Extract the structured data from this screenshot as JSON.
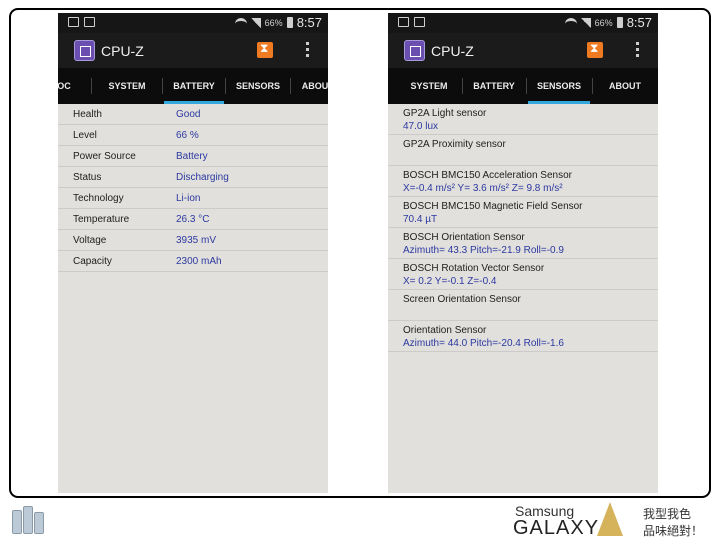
{
  "status_bar": {
    "battery_pct": "66%",
    "time": "8:57"
  },
  "app": {
    "title": "CPU-Z"
  },
  "left_tabs": [
    "OC",
    "SYSTEM",
    "BATTERY",
    "SENSORS",
    "ABOU"
  ],
  "right_tabs": [
    "SYSTEM",
    "BATTERY",
    "SENSORS",
    "ABOUT"
  ],
  "battery": [
    {
      "label": "Health",
      "value": "Good"
    },
    {
      "label": "Level",
      "value": "66 %"
    },
    {
      "label": "Power Source",
      "value": "Battery"
    },
    {
      "label": "Status",
      "value": "Discharging"
    },
    {
      "label": "Technology",
      "value": "Li-ion"
    },
    {
      "label": "Temperature",
      "value": "26.3 °C"
    },
    {
      "label": "Voltage",
      "value": "3935 mV"
    },
    {
      "label": "Capacity",
      "value": "2300 mAh"
    }
  ],
  "sensors": [
    {
      "name": "GP2A Light sensor",
      "value": "47.0 lux"
    },
    {
      "name": "GP2A Proximity sensor",
      "value": ""
    },
    {
      "name": "BOSCH BMC150 Acceleration Sensor",
      "value": "X=-0.4 m/s²  Y= 3.6 m/s²  Z= 9.8 m/s²"
    },
    {
      "name": "BOSCH BMC150 Magnetic Field Sensor",
      "value": "70.4 µT"
    },
    {
      "name": "BOSCH Orientation Sensor",
      "value": "Azimuth= 43.3  Pitch=-21.9  Roll=-0.9"
    },
    {
      "name": "BOSCH Rotation Vector Sensor",
      "value": "X= 0.2  Y=-0.1  Z=-0.4"
    },
    {
      "name": "Screen Orientation Sensor",
      "value": ""
    },
    {
      "name": "Orientation Sensor",
      "value": "Azimuth= 44.0  Pitch=-20.4  Roll=-1.6"
    }
  ],
  "brand": {
    "samsung": "Samsung",
    "galaxy": "GALAXY",
    "slogan_line1": "我型我色",
    "slogan_line2": "品味絕對！"
  },
  "colors": {
    "accent_tab": "#33a8dc",
    "value_text": "#2b39a0",
    "app_icon": "#6a4fb0",
    "action_icon": "#ee7a22"
  },
  "icons": [
    "image-icon",
    "sim-icon",
    "wifi-icon",
    "signal-icon",
    "battery-icon",
    "cpu-z-logo-icon",
    "share-icon",
    "overflow-menu-icon"
  ]
}
